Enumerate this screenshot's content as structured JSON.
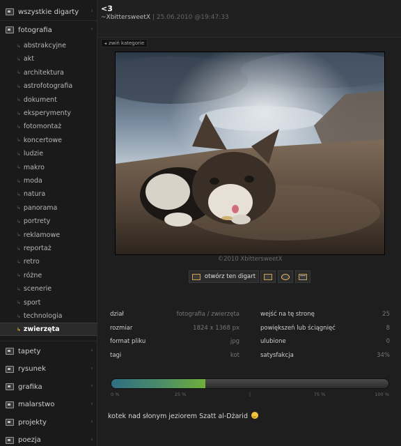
{
  "header": {
    "title": "<3",
    "author": "~XbittersweetX",
    "separator": "|",
    "date": "25.06.2010 @19:47:33"
  },
  "collapse_label": "zwiń kategorie",
  "sidebar": {
    "top_item": {
      "label": "wszystkie digarty",
      "icon": "folder-icon"
    },
    "open_category": {
      "label": "fotografia",
      "icon": "camera-icon"
    },
    "subcategories": [
      "abstrakcyjne",
      "akt",
      "architektura",
      "astrofotografia",
      "dokument",
      "eksperymenty",
      "fotomontaż",
      "koncertowe",
      "ludzie",
      "makro",
      "moda",
      "natura",
      "panorama",
      "portrety",
      "reklamowe",
      "reportaż",
      "retro",
      "różne",
      "scenerie",
      "sport",
      "technologia",
      "zwierzęta"
    ],
    "active_subcategory": "zwierzęta",
    "bottom_categories": [
      {
        "label": "tapety",
        "icon": "wallpaper-icon"
      },
      {
        "label": "rysunek",
        "icon": "pencil-icon"
      },
      {
        "label": "grafika",
        "icon": "graphics-icon"
      },
      {
        "label": "malarstwo",
        "icon": "palette-icon"
      },
      {
        "label": "projekty",
        "icon": "projects-icon"
      },
      {
        "label": "poezja",
        "icon": "poetry-icon"
      }
    ]
  },
  "photo": {
    "copyright": "©2010 XbittersweetX"
  },
  "buttons": {
    "open_label": "otwórz ten digart"
  },
  "stats_left": [
    {
      "label": "dział",
      "value": "fotografia / zwierzęta"
    },
    {
      "label": "rozmiar",
      "value": "1824 x 1368 px"
    },
    {
      "label": "format pliku",
      "value": "jpg"
    },
    {
      "label": "tagi",
      "value": "kot"
    }
  ],
  "stats_right": [
    {
      "label": "wejść na tę stronę",
      "value": "25"
    },
    {
      "label": "powiększeń lub ściągnięć",
      "value": "8"
    },
    {
      "label": "ulubione",
      "value": "0"
    },
    {
      "label": "satysfakcja",
      "value": "34%"
    }
  ],
  "satisfaction_fraction": 0.34,
  "scale_ticks": [
    "0 %",
    "25 %",
    "|",
    "75 %",
    "100 %"
  ],
  "description": "kotek nad słonym jeziorem Szatt al-Dżarid",
  "colors": {
    "accent": "#f2a33a",
    "bar_start": "#2e6e82",
    "bar_end": "#6fae3a"
  }
}
